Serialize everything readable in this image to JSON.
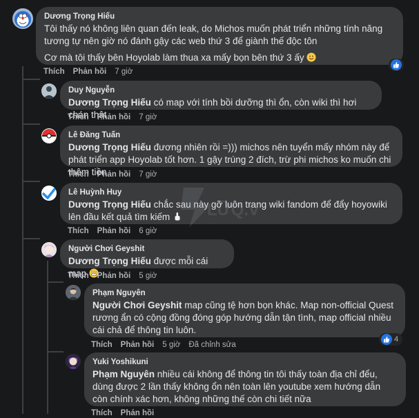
{
  "comments": [
    {
      "author": "Dương Trọng Hiếu",
      "paragraphs": [
        "Tôi thấy nó không liên quan đến leak, do Michos muốn phát triển những tính năng tương tự nên giờ nó đánh gậy các web thứ 3 để giành thế độc tôn",
        "Cơ mà tôi thấy bên Hoyolab làm thua xa mấy bọn bên thứ 3 ấy"
      ],
      "like_label": "Thích",
      "reply_label": "Phản hồi",
      "time": "7 giờ",
      "reaction": "like-icon"
    },
    {
      "author": "Duy Nguyễn",
      "mention": "Dương Trọng Hiếu",
      "text": " có map với tính bồi dưỡng thì ổn, còn wiki thì hơi chán thật",
      "like_label": "Thích",
      "reply_label": "Phản hồi",
      "time": "7 giờ"
    },
    {
      "author": "Lê Đăng Tuấn",
      "mention": "Dương Trọng Hiếu",
      "text": " đương nhiên rồi =))) michos nên tuyển mấy nhóm này để phát triển app Hoyolab tốt hơn. 1 gậy trúng 2 đích, trừ phi michos ko muốn chi thêm tiền",
      "like_label": "Thích",
      "reply_label": "Phản hồi",
      "time": "7 giờ"
    },
    {
      "author": "Lê Huỳnh Huy",
      "mention": "Dương Trọng Hiếu",
      "text": " chắc sau này gỡ luôn trang wiki fandom để đẩy hoyowiki lên đầu kết quả tìm kiếm",
      "like_label": "Thích",
      "reply_label": "Phản hồi",
      "time": "6 giờ"
    },
    {
      "author": "Người Chơi Geyshit",
      "mention": "Dương Trọng Hiếu",
      "text": " được mỗi cái map",
      "like_label": "Thích",
      "reply_label": "Phản hồi",
      "time": "5 giờ"
    },
    {
      "author": "Phạm Nguyên",
      "mention": "Người Chơi Geyshit",
      "text": " map cũng tệ hơn bọn khác. Map non-official Quest rương ẩn có cộng đồng đóng góp hướng dẫn tận tình, map official nhiều cái chả để thông tin luôn.",
      "like_label": "Thích",
      "reply_label": "Phản hồi",
      "time": "5 giờ",
      "edited": "Đã chỉnh sửa",
      "reaction_count": "4"
    },
    {
      "author": "Yuki Yoshikuni",
      "mention": "Phạm Nguyên",
      "text": " nhiều cái không để thông tin tôi thấy toàn địa chỉ đểu, dùng được 2 lần thấy không ổn nên toàn lên youtube xem hướng dẫn còn chính xác hơn, không những thế còn chi tiết nữa",
      "like_label": "Thích",
      "reply_label": "Phản hồi"
    }
  ],
  "watermark": "LỮQ.VN",
  "colors": {
    "background": "#18191a",
    "bubble": "#3a3b3c",
    "text": "#e4e6eb",
    "muted": "#b0b3b8",
    "like_blue": "#2374e1"
  }
}
